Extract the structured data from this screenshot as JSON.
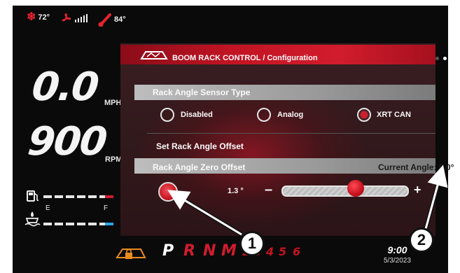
{
  "status": {
    "ac_temp": "72°",
    "temp": "84°"
  },
  "gauges": {
    "speed": "0.0",
    "speed_unit": "MPH",
    "rpm": "900",
    "rpm_unit": "RPM",
    "empty_label": "E",
    "full_label": "F"
  },
  "panel": {
    "title": "BOOM RACK CONTROL / Configuration",
    "sensor_type": {
      "label": "Rack Angle Sensor Type",
      "options": [
        "Disabled",
        "Analog",
        "XRT CAN"
      ],
      "selected": "XRT CAN"
    },
    "offset_heading": "Set Rack Angle Offset",
    "zero_offset": {
      "label": "Rack Angle Zero Offset",
      "current_angle_label": "Current Angle:",
      "current_angle": "0.0°",
      "offset_value": "1.3 °",
      "slider_fraction": 0.6,
      "minus": "–",
      "plus": "+"
    }
  },
  "bottom": {
    "gears": [
      {
        "label": "P",
        "color": "#ffffff"
      },
      {
        "label": "R",
        "color": "#d11c2c"
      },
      {
        "label": "N",
        "color": "#d11c2c"
      },
      {
        "label": "M",
        "color": "#d11c2c"
      },
      {
        "label": "2",
        "color": "#c4141f"
      },
      {
        "label": "3",
        "color": "#c4141f"
      },
      {
        "label": "4",
        "color": "#c4141f"
      },
      {
        "label": "5",
        "color": "#c4141f"
      },
      {
        "label": "6",
        "color": "#c4141f"
      }
    ],
    "time": "9:00",
    "date": "5/3/2023"
  },
  "callouts": [
    "1",
    "2"
  ],
  "colors": {
    "accent": "#d11c2c",
    "warning": "#e98c1e",
    "water": "#2aa6e8"
  }
}
